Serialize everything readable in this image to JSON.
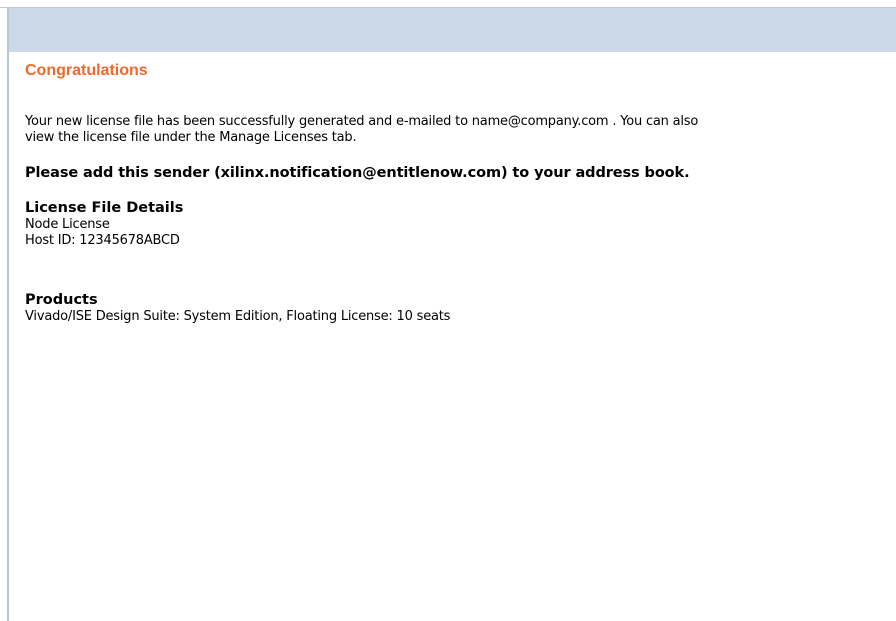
{
  "heading": "Congratulations",
  "message": {
    "before_email": "Your new license file has been successfully generated and e-mailed to ",
    "email": "name@company.com",
    "after_email_line1": " . You can also",
    "line2": "view the license file under the Manage Licenses tab."
  },
  "notice": "Please add this sender (xilinx.notification@entitlenow.com) to your address book.",
  "license_details": {
    "title": "License File Details",
    "type": "Node License",
    "host_id": "Host ID: 12345678ABCD"
  },
  "products": {
    "title": "Products",
    "items": [
      "Vivado/ISE Design Suite: System Edition, Floating License: 10 seats"
    ]
  },
  "colors": {
    "heading": "#f2682a",
    "header_band": "#cbd9e8",
    "frame_border": "#b9c7da"
  }
}
